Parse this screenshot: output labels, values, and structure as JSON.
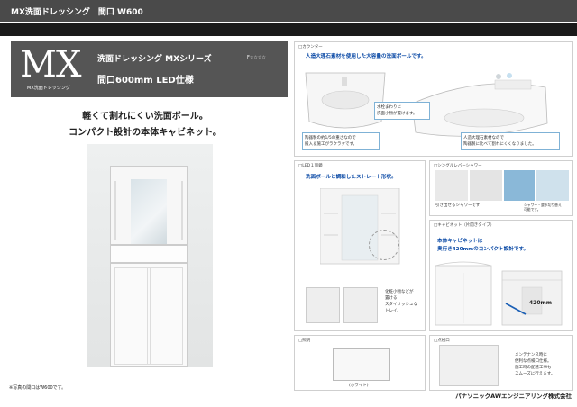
{
  "header": {
    "title": "MX洗面ドレッシング　間口 W600"
  },
  "product": {
    "logo": "MX",
    "logo_sub": "MX洗面ドレッシング",
    "series_title": "洗面ドレッシング  MXシリーズ",
    "rank": "F☆☆☆☆",
    "size_title": "間口600mm  LED仕様"
  },
  "catch": {
    "line1": "軽くて割れにくい洗面ボール。",
    "line2": "コンパクト設計の本体キャビネット。"
  },
  "photo_note": "※写真の間口はW600です。",
  "counter": {
    "label": "□カウンター",
    "head": "人造大理石素材を使用した大容量の洗面ボールです。",
    "callout1": "水栓まわりに\n洗面小物が置けます。",
    "callout2": "陶器製の約1/5の重さなので\n搬入＆施工がラクラクです。",
    "callout3": "人造大理石素材なので\n陶器製に比べて割れにくくなりました。"
  },
  "led": {
    "label": "□LED１面鏡",
    "head": "洗面ボールと調和したストレート形状。",
    "note": "化粧小物などが\n置ける\nスタイリッシュな\nトレイ。"
  },
  "shower": {
    "label": "□シングルレバーシャワー",
    "note1": "引き出せるシャワーです",
    "note2": "シャワー・整水切り替え\n可能です。"
  },
  "cabinet": {
    "label": "□キャビネット（片開きタイプ）",
    "head1": "本体キャビネットは",
    "head2": "奥行き420mmのコンパクト設計です。",
    "depth": "420mm"
  },
  "lighting": {
    "label": "□照明",
    "color_note": "(ホワイト)"
  },
  "maint": {
    "label": "□点検口",
    "note": "メンテナンス時に\n便利な点検口仕様。\n施工時の配管工事も\nスムーズに行えます。"
  },
  "footer": {
    "company": "パナソニックAWエンジニアリング株式会社"
  },
  "colors": {
    "accent_blue": "#0b4aa6",
    "header_gray": "#555555",
    "topbar": "#4a4a4a"
  }
}
